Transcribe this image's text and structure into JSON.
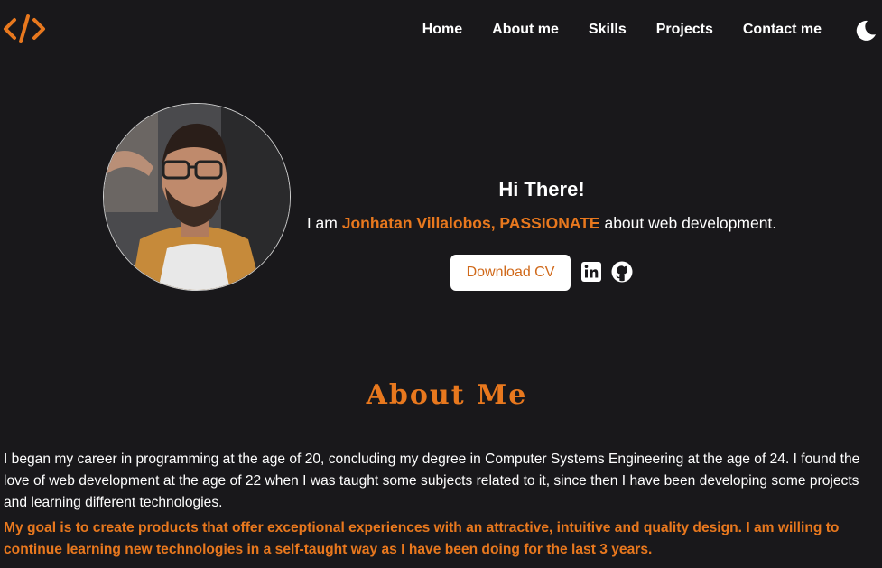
{
  "nav": {
    "items": [
      {
        "label": "Home"
      },
      {
        "label": "About me"
      },
      {
        "label": "Skills"
      },
      {
        "label": "Projects"
      },
      {
        "label": "Contact me"
      }
    ],
    "theme_icon": "moon-icon",
    "logo_icon": "code-brackets-icon"
  },
  "hero": {
    "title": "Hi There!",
    "intro_prefix": "I am ",
    "intro_highlight": "Jonhatan Villalobos, PASSIONATE",
    "intro_suffix": " about web development.",
    "cv_label": "Download CV",
    "social_icons": [
      "linkedin-icon",
      "github-icon"
    ],
    "avatar": "profile-photo"
  },
  "about": {
    "title": "About Me",
    "paragraph": "I began my career in programming at the age of 20, concluding my degree in Computer Systems Engineering at the age of 24. I found the love of web development at the age of 22 when I was taught some subjects related to it, since then I have been developing some projects and learning different technologies.",
    "goal": "My goal is to create products that offer exceptional experiences with an attractive, intuitive and quality design. I am willing to continue learning new technologies in a self-taught way as I have been doing for the last 3 years."
  },
  "colors": {
    "accent": "#e8781e",
    "background": "#19181b",
    "text": "#ffffff"
  }
}
